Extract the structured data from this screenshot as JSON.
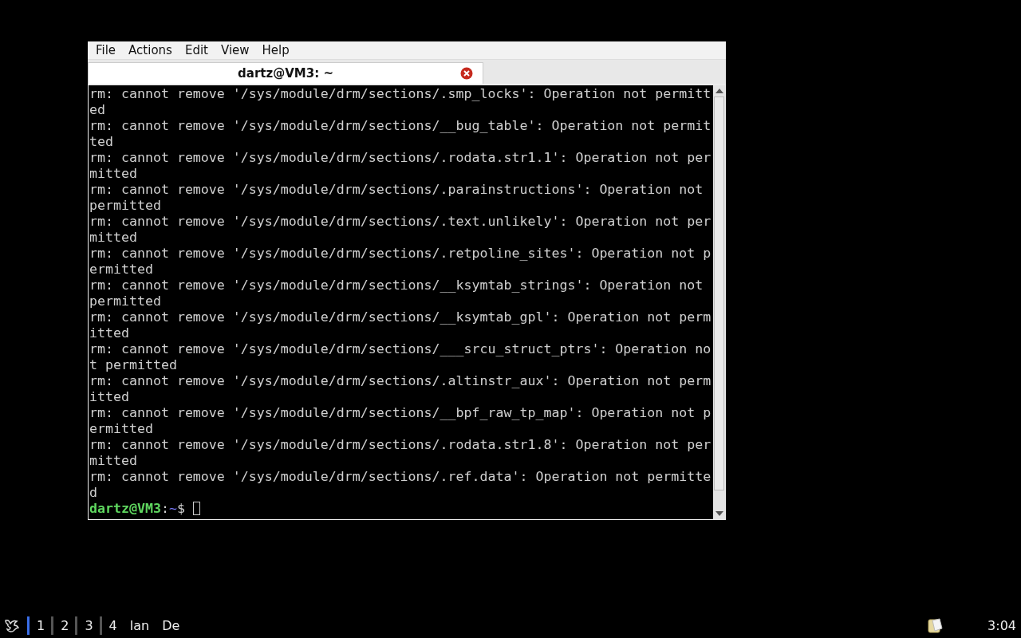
{
  "window": {
    "menu": [
      "File",
      "Actions",
      "Edit",
      "View",
      "Help"
    ],
    "tabs": [
      {
        "title": "dartz@VM3: ~",
        "selected": true
      }
    ]
  },
  "terminal": {
    "lines": [
      "rm: cannot remove '/sys/module/drm/sections/.smp_locks': Operation not permitted",
      "rm: cannot remove '/sys/module/drm/sections/__bug_table': Operation not permitted",
      "rm: cannot remove '/sys/module/drm/sections/.rodata.str1.1': Operation not permitted",
      "rm: cannot remove '/sys/module/drm/sections/.parainstructions': Operation not permitted",
      "rm: cannot remove '/sys/module/drm/sections/.text.unlikely': Operation not permitted",
      "rm: cannot remove '/sys/module/drm/sections/.retpoline_sites': Operation not permitted",
      "rm: cannot remove '/sys/module/drm/sections/__ksymtab_strings': Operation not permitted",
      "rm: cannot remove '/sys/module/drm/sections/__ksymtab_gpl': Operation not permitted",
      "rm: cannot remove '/sys/module/drm/sections/___srcu_struct_ptrs': Operation not permitted",
      "rm: cannot remove '/sys/module/drm/sections/.altinstr_aux': Operation not permitted",
      "rm: cannot remove '/sys/module/drm/sections/__bpf_raw_tp_map': Operation not permitted",
      "rm: cannot remove '/sys/module/drm/sections/.rodata.str1.8': Operation not permitted",
      "rm: cannot remove '/sys/module/drm/sections/.ref.data': Operation not permitted"
    ],
    "prompt": {
      "user_host": "dartz@VM3",
      "separator": ":",
      "path": "~",
      "symbol": "$"
    }
  },
  "taskbar": {
    "workspaces": [
      {
        "label": "1",
        "selected": true
      },
      {
        "label": "2",
        "selected": false
      },
      {
        "label": "3",
        "selected": false
      },
      {
        "label": "4",
        "selected": false
      }
    ],
    "tasks": [
      "lan",
      "De"
    ],
    "clock": "3:04"
  }
}
